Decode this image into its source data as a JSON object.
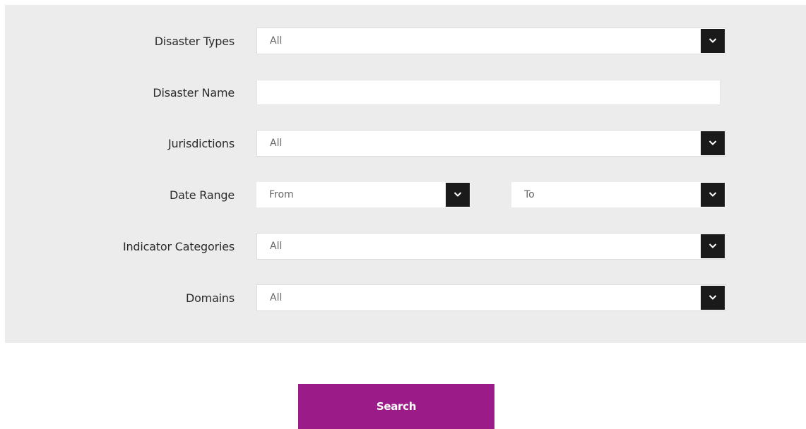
{
  "form": {
    "disaster_types": {
      "label": "Disaster Types",
      "value": "All"
    },
    "disaster_name": {
      "label": "Disaster Name",
      "value": ""
    },
    "jurisdictions": {
      "label": "Jurisdictions",
      "value": "All"
    },
    "date_range": {
      "label": "Date Range",
      "from": "From",
      "to": "To"
    },
    "indicator_categories": {
      "label": "Indicator Categories",
      "value": "All"
    },
    "domains": {
      "label": "Domains",
      "value": "All"
    }
  },
  "search_button": {
    "label": "Search"
  },
  "icons": {
    "dropdown": "chevron-down-icon"
  },
  "colors": {
    "panel_bg": "#ececec",
    "dropdown_arrow_bg": "#1a1a1a",
    "search_button_bg": "#9b1b88",
    "search_button_text": "#ffffff"
  }
}
